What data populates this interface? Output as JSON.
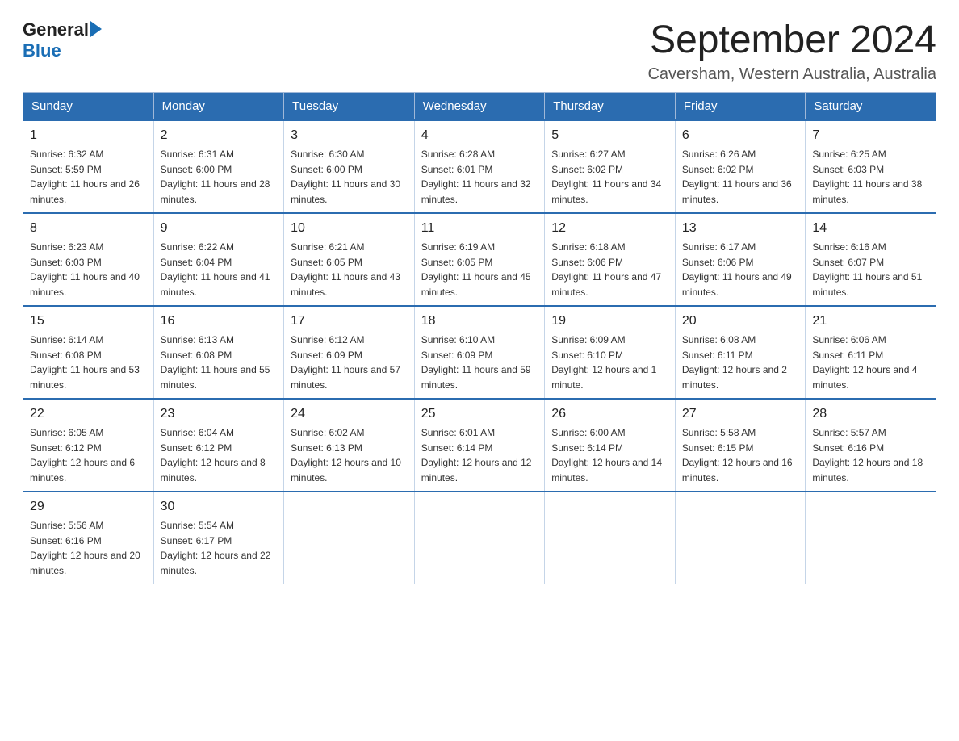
{
  "header": {
    "logo_general": "General",
    "logo_blue": "Blue",
    "title": "September 2024",
    "subtitle": "Caversham, Western Australia, Australia"
  },
  "calendar": {
    "days_of_week": [
      "Sunday",
      "Monday",
      "Tuesday",
      "Wednesday",
      "Thursday",
      "Friday",
      "Saturday"
    ],
    "weeks": [
      [
        {
          "day": "1",
          "sunrise": "6:32 AM",
          "sunset": "5:59 PM",
          "daylight": "11 hours and 26 minutes."
        },
        {
          "day": "2",
          "sunrise": "6:31 AM",
          "sunset": "6:00 PM",
          "daylight": "11 hours and 28 minutes."
        },
        {
          "day": "3",
          "sunrise": "6:30 AM",
          "sunset": "6:00 PM",
          "daylight": "11 hours and 30 minutes."
        },
        {
          "day": "4",
          "sunrise": "6:28 AM",
          "sunset": "6:01 PM",
          "daylight": "11 hours and 32 minutes."
        },
        {
          "day": "5",
          "sunrise": "6:27 AM",
          "sunset": "6:02 PM",
          "daylight": "11 hours and 34 minutes."
        },
        {
          "day": "6",
          "sunrise": "6:26 AM",
          "sunset": "6:02 PM",
          "daylight": "11 hours and 36 minutes."
        },
        {
          "day": "7",
          "sunrise": "6:25 AM",
          "sunset": "6:03 PM",
          "daylight": "11 hours and 38 minutes."
        }
      ],
      [
        {
          "day": "8",
          "sunrise": "6:23 AM",
          "sunset": "6:03 PM",
          "daylight": "11 hours and 40 minutes."
        },
        {
          "day": "9",
          "sunrise": "6:22 AM",
          "sunset": "6:04 PM",
          "daylight": "11 hours and 41 minutes."
        },
        {
          "day": "10",
          "sunrise": "6:21 AM",
          "sunset": "6:05 PM",
          "daylight": "11 hours and 43 minutes."
        },
        {
          "day": "11",
          "sunrise": "6:19 AM",
          "sunset": "6:05 PM",
          "daylight": "11 hours and 45 minutes."
        },
        {
          "day": "12",
          "sunrise": "6:18 AM",
          "sunset": "6:06 PM",
          "daylight": "11 hours and 47 minutes."
        },
        {
          "day": "13",
          "sunrise": "6:17 AM",
          "sunset": "6:06 PM",
          "daylight": "11 hours and 49 minutes."
        },
        {
          "day": "14",
          "sunrise": "6:16 AM",
          "sunset": "6:07 PM",
          "daylight": "11 hours and 51 minutes."
        }
      ],
      [
        {
          "day": "15",
          "sunrise": "6:14 AM",
          "sunset": "6:08 PM",
          "daylight": "11 hours and 53 minutes."
        },
        {
          "day": "16",
          "sunrise": "6:13 AM",
          "sunset": "6:08 PM",
          "daylight": "11 hours and 55 minutes."
        },
        {
          "day": "17",
          "sunrise": "6:12 AM",
          "sunset": "6:09 PM",
          "daylight": "11 hours and 57 minutes."
        },
        {
          "day": "18",
          "sunrise": "6:10 AM",
          "sunset": "6:09 PM",
          "daylight": "11 hours and 59 minutes."
        },
        {
          "day": "19",
          "sunrise": "6:09 AM",
          "sunset": "6:10 PM",
          "daylight": "12 hours and 1 minute."
        },
        {
          "day": "20",
          "sunrise": "6:08 AM",
          "sunset": "6:11 PM",
          "daylight": "12 hours and 2 minutes."
        },
        {
          "day": "21",
          "sunrise": "6:06 AM",
          "sunset": "6:11 PM",
          "daylight": "12 hours and 4 minutes."
        }
      ],
      [
        {
          "day": "22",
          "sunrise": "6:05 AM",
          "sunset": "6:12 PM",
          "daylight": "12 hours and 6 minutes."
        },
        {
          "day": "23",
          "sunrise": "6:04 AM",
          "sunset": "6:12 PM",
          "daylight": "12 hours and 8 minutes."
        },
        {
          "day": "24",
          "sunrise": "6:02 AM",
          "sunset": "6:13 PM",
          "daylight": "12 hours and 10 minutes."
        },
        {
          "day": "25",
          "sunrise": "6:01 AM",
          "sunset": "6:14 PM",
          "daylight": "12 hours and 12 minutes."
        },
        {
          "day": "26",
          "sunrise": "6:00 AM",
          "sunset": "6:14 PM",
          "daylight": "12 hours and 14 minutes."
        },
        {
          "day": "27",
          "sunrise": "5:58 AM",
          "sunset": "6:15 PM",
          "daylight": "12 hours and 16 minutes."
        },
        {
          "day": "28",
          "sunrise": "5:57 AM",
          "sunset": "6:16 PM",
          "daylight": "12 hours and 18 minutes."
        }
      ],
      [
        {
          "day": "29",
          "sunrise": "5:56 AM",
          "sunset": "6:16 PM",
          "daylight": "12 hours and 20 minutes."
        },
        {
          "day": "30",
          "sunrise": "5:54 AM",
          "sunset": "6:17 PM",
          "daylight": "12 hours and 22 minutes."
        },
        null,
        null,
        null,
        null,
        null
      ]
    ]
  }
}
